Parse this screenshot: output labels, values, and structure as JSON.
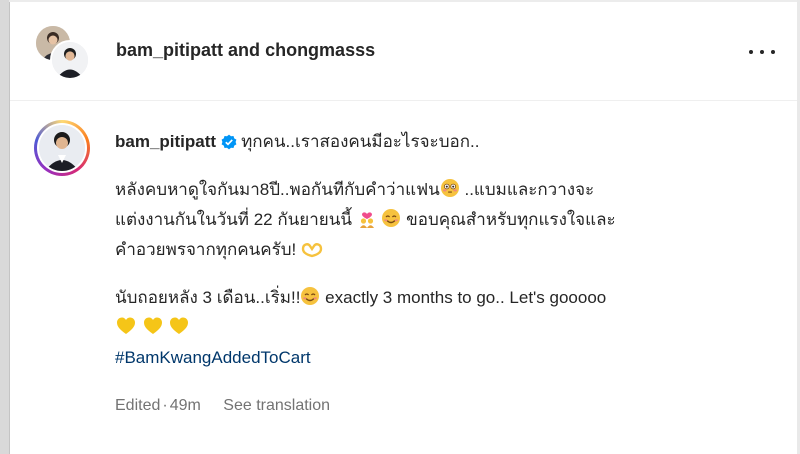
{
  "header": {
    "user_one": "bam_pitipatt",
    "conjunction": "and",
    "user_two": "chongmasss"
  },
  "post": {
    "username": "bam_pitipatt",
    "line_intro": "ทุกคน..เราสองคนมีอะไรจะบอก..",
    "para1_line1": "หลังคบหาดูใจกันมา8ปี..พอกันทีกับคำว่าแฟน",
    "para1_line1_end": " ..แบมและกวางจะ",
    "para1_line2": "แต่งงานกันในวันที่ 22 กันยายนนี้",
    "para1_line2_end": " ขอบคุณสำหรับทุกแรงใจและ",
    "para1_line3": "คำอวยพรจากทุกคนครับ!",
    "para2_line1": "นับถอยหลัง 3 เดือน..เริ่ม!!",
    "para2_line1_end": " exactly 3 months to go.. Let's gooooo",
    "hashtag": "#BamKwangAddedToCart"
  },
  "meta": {
    "edited": "Edited",
    "separator": "·",
    "time": "49m",
    "see_translation": "See translation"
  },
  "icons": {
    "more": "more-options-icon",
    "verified": "verified-badge-icon"
  },
  "colors": {
    "verified": "#0095f6",
    "hashtag": "#00376b",
    "meta": "#737373",
    "heart": "#f5c518"
  }
}
